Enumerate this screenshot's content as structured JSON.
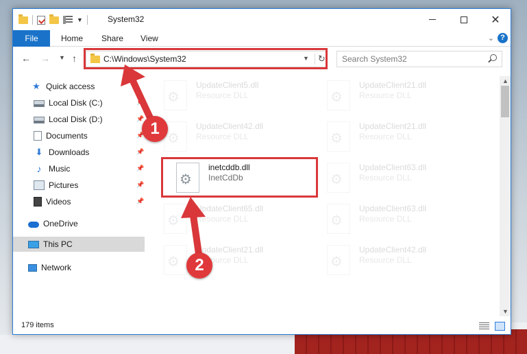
{
  "window": {
    "title": "System32"
  },
  "ribbon": {
    "tabs": [
      "File",
      "Home",
      "Share",
      "View"
    ]
  },
  "navigation": {
    "address": "C:\\Windows\\System32",
    "search_placeholder": "Search System32"
  },
  "sidebar": {
    "items": [
      {
        "label": "Quick access",
        "icon": "star-icon",
        "pinned": false
      },
      {
        "label": "Local Disk (C:)",
        "icon": "disk-icon",
        "pinned": true
      },
      {
        "label": "Local Disk (D:)",
        "icon": "disk-icon",
        "pinned": true
      },
      {
        "label": "Documents",
        "icon": "documents-icon",
        "pinned": true
      },
      {
        "label": "Downloads",
        "icon": "download-icon",
        "pinned": true
      },
      {
        "label": "Music",
        "icon": "music-icon",
        "pinned": true
      },
      {
        "label": "Pictures",
        "icon": "pictures-icon",
        "pinned": true
      },
      {
        "label": "Videos",
        "icon": "videos-icon",
        "pinned": true
      },
      {
        "label": "OneDrive",
        "icon": "cloud-icon",
        "pinned": false
      },
      {
        "label": "This PC",
        "icon": "computer-icon",
        "pinned": false,
        "selected": true
      },
      {
        "label": "Network",
        "icon": "network-icon",
        "pinned": false
      }
    ]
  },
  "files": [
    {
      "name": "UpdateClient5.dll",
      "type": "Resource DLL",
      "faded": true
    },
    {
      "name": "UpdateClient21.dll",
      "type": "Resource DLL",
      "faded": true
    },
    {
      "name": "UpdateClient42.dll",
      "type": "Resource DLL",
      "faded": true
    },
    {
      "name": "UpdateClient21.dll",
      "type": "Resource DLL",
      "faded": true
    },
    {
      "name": "inetcddb.dll",
      "type": "InetCdDb",
      "faded": false
    },
    {
      "name": "UpdateClient63.dll",
      "type": "Resource DLL",
      "faded": true
    },
    {
      "name": "UpdateClient65.dll",
      "type": "Resource DLL",
      "faded": true
    },
    {
      "name": "UpdateClient63.dll",
      "type": "Resource DLL",
      "faded": true
    },
    {
      "name": "UpdateClient21.dll",
      "type": "Resource DLL",
      "faded": true
    },
    {
      "name": "UpdateClient42.dll",
      "type": "Resource DLL",
      "faded": true
    }
  ],
  "status": {
    "item_count": "179 items"
  },
  "annotations": {
    "step1": "1",
    "step2": "2",
    "color": "#d9373a"
  }
}
